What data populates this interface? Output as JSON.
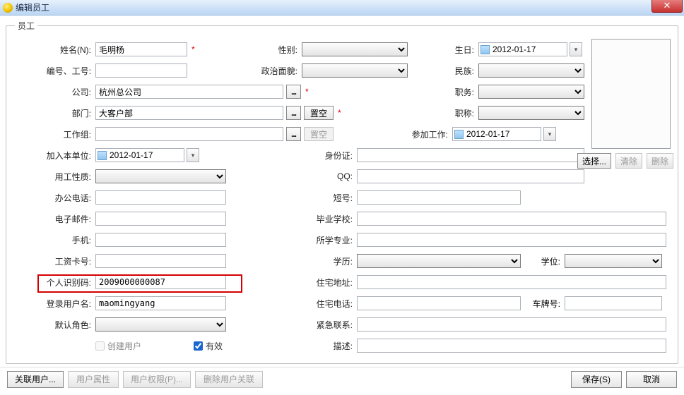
{
  "window": {
    "title": "编辑员工"
  },
  "legend": "员工",
  "labels": {
    "name": "姓名(N):",
    "gender": "性别:",
    "birthday": "生日:",
    "number": "编号、工号:",
    "political": "政治面貌:",
    "nation": "民族:",
    "company": "公司:",
    "position": "职务:",
    "dept": "部门:",
    "title": "职称:",
    "workgroup": "工作组:",
    "joinwork": "参加工作:",
    "joinunit": "加入本单位:",
    "idcard": "身份证:",
    "employtype": "用工性质:",
    "qq": "QQ:",
    "officephone": "办公电话:",
    "shortnum": "短号:",
    "email": "电子邮件:",
    "school": "毕业学校:",
    "mobile": "手机:",
    "major": "所学专业:",
    "salarycard": "工资卡号:",
    "education": "学历:",
    "degree": "学位:",
    "personalcode": "个人识别码:",
    "homeaddr": "住宅地址:",
    "loginuser": "登录用户名:",
    "homephone": "住宅电话:",
    "carnum": "车牌号:",
    "defaultrole": "默认角色:",
    "emergency": "紧急联系:",
    "createuser": "创建用户",
    "valid": "有效",
    "desc": "描述:"
  },
  "values": {
    "name": "毛明杨",
    "company": "杭州总公司",
    "dept": "大客户部",
    "date_birthday": "2012-01-17",
    "date_joinwork": "2012-01-17",
    "date_joinunit": "2012-01-17",
    "personalcode": "2009000000087",
    "loginuser": "maomingyang",
    "valid_checked": true,
    "createuser_checked": false
  },
  "buttons": {
    "dots": "...",
    "reset": "置空",
    "select_photo": "选择...",
    "clear_photo": "清除",
    "delete_photo": "删除",
    "assoc_user": "关联用户...",
    "user_prop": "用户属性",
    "user_perm": "用户权限(P)...",
    "del_assoc": "删除用户关联",
    "save": "保存(S)",
    "cancel": "取消"
  }
}
